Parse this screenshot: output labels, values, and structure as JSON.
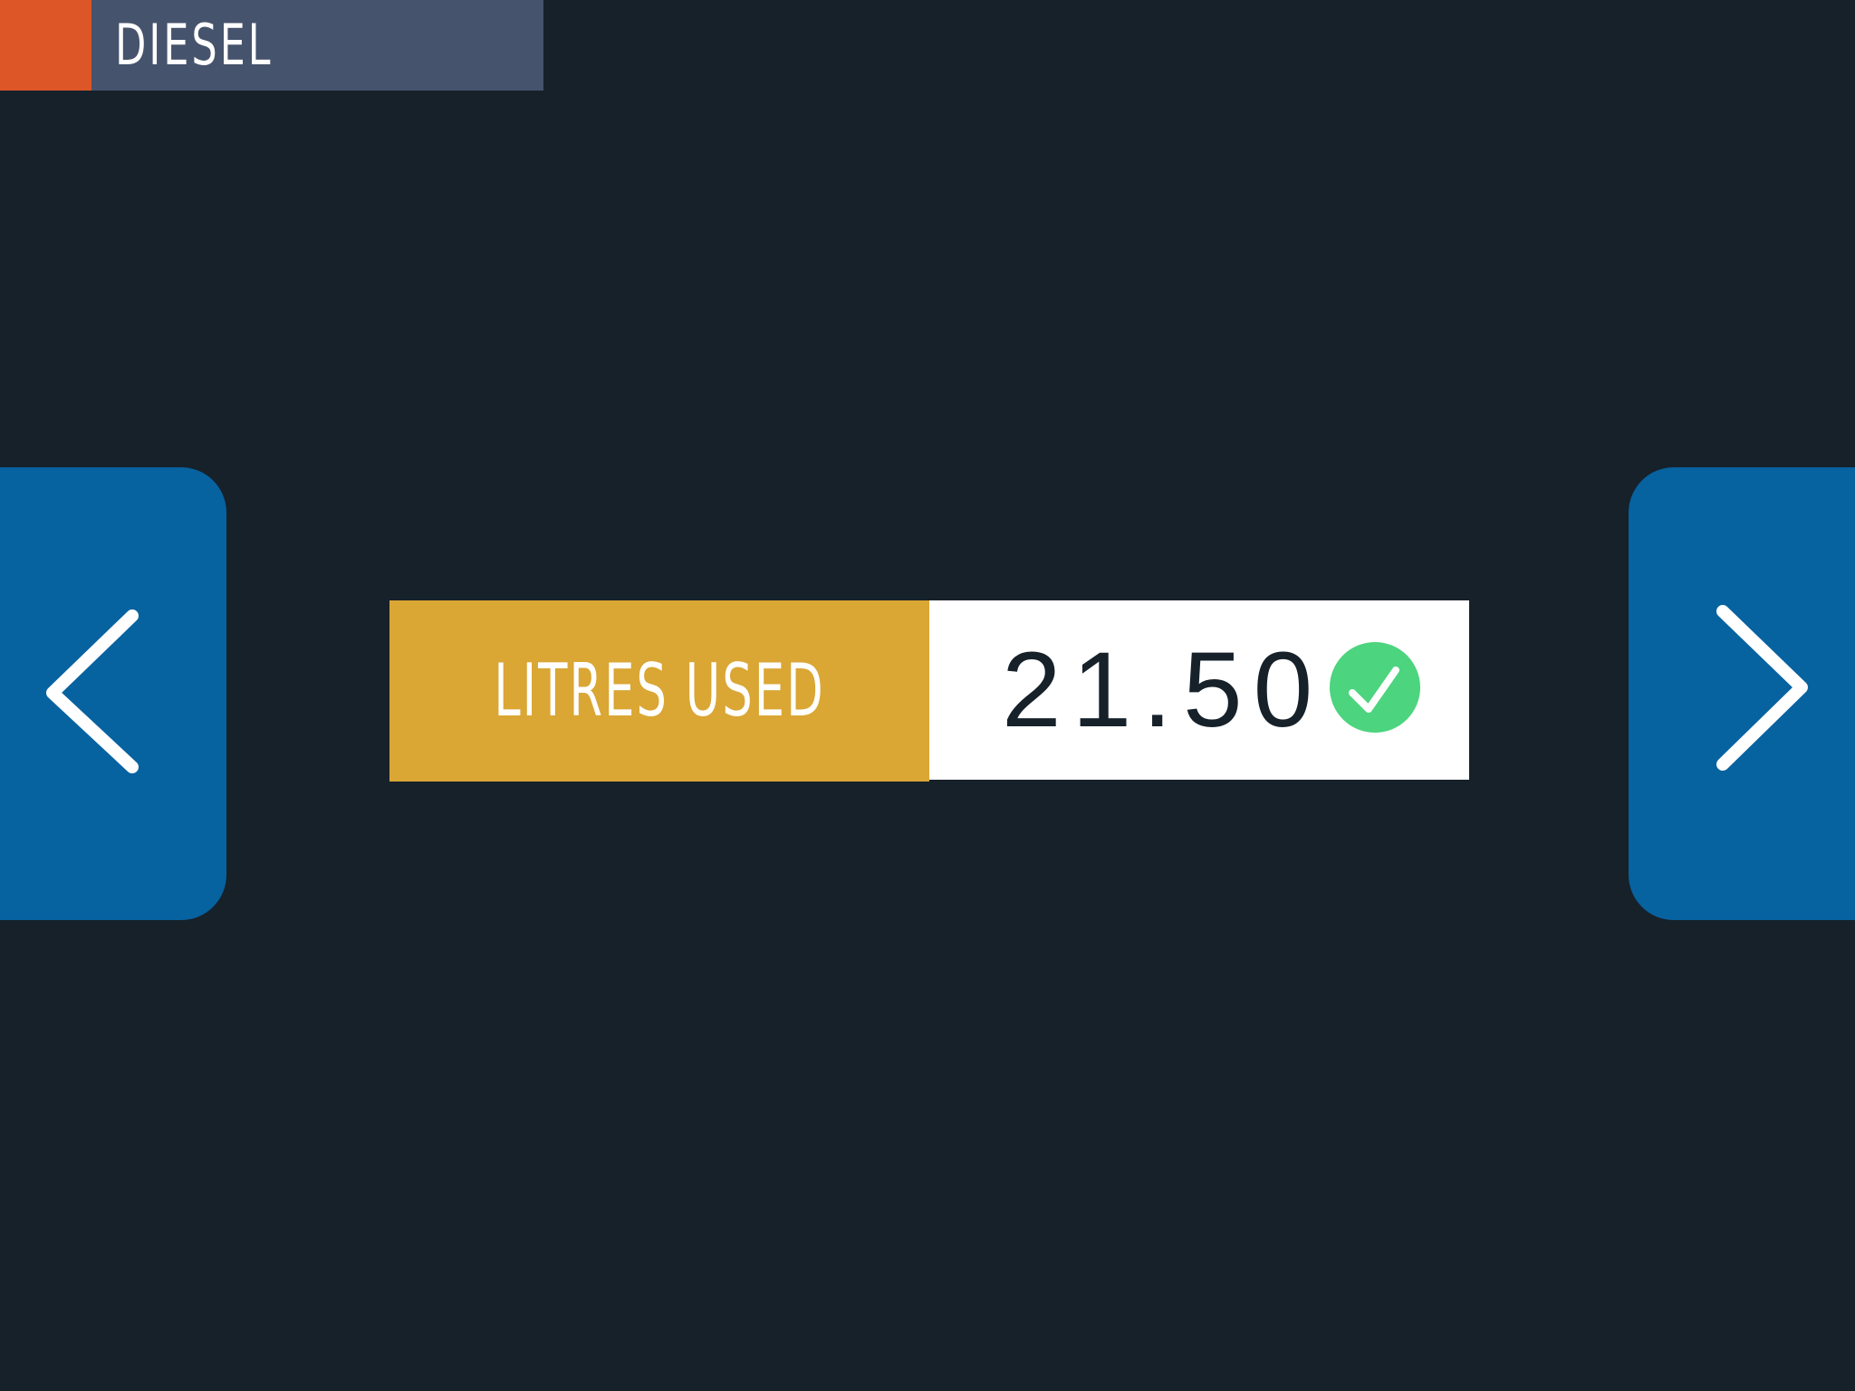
{
  "header": {
    "title": "DIESEL"
  },
  "field": {
    "label": "LITRES USED",
    "value": "21.50",
    "status_icon": "check-circle-icon",
    "status": "valid"
  },
  "navigation": {
    "prev_icon": "chevron-left-icon",
    "next_icon": "chevron-right-icon"
  },
  "colors": {
    "background": "#16212a",
    "header_accent": "#dc5628",
    "header_bar": "#46536c",
    "nav_button": "#0762a0",
    "label_background": "#daa634",
    "value_background": "#ffffff",
    "success": "#4cd47e"
  }
}
